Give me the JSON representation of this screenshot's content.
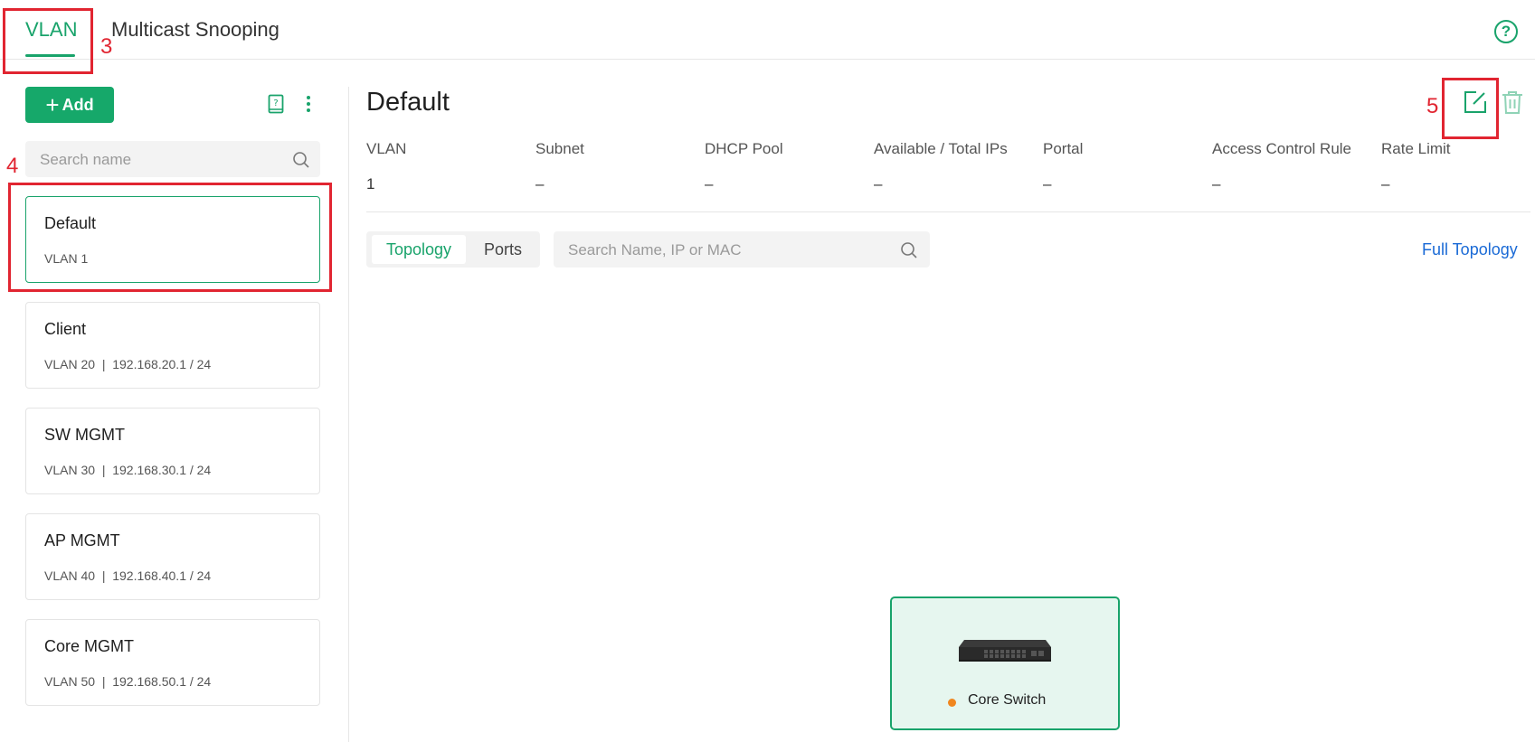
{
  "tabs": [
    {
      "label": "VLAN",
      "active": true
    },
    {
      "label": "Multicast Snooping",
      "active": false
    }
  ],
  "annotations": {
    "tab": "3",
    "list": "4",
    "edit": "5"
  },
  "left": {
    "add_label": "Add",
    "search_placeholder": "Search name",
    "vlans": [
      {
        "name": "Default",
        "sub": "VLAN 1",
        "selected": true
      },
      {
        "name": "Client",
        "sub": "VLAN 20  |  192.168.20.1 / 24",
        "selected": false
      },
      {
        "name": "SW MGMT",
        "sub": "VLAN 30  |  192.168.30.1 / 24",
        "selected": false
      },
      {
        "name": "AP MGMT",
        "sub": "VLAN 40  |  192.168.40.1 / 24",
        "selected": false
      },
      {
        "name": "Core MGMT",
        "sub": "VLAN 50  |  192.168.50.1 / 24",
        "selected": false
      }
    ]
  },
  "detail": {
    "title": "Default",
    "columns": [
      {
        "header": "VLAN",
        "value": "1"
      },
      {
        "header": "Subnet",
        "value": "–"
      },
      {
        "header": "DHCP Pool",
        "value": "–"
      },
      {
        "header": "Available / Total IPs",
        "value": "–"
      },
      {
        "header": "Portal",
        "value": "–"
      },
      {
        "header": "Access Control Rule",
        "value": "–"
      },
      {
        "header": "Rate Limit",
        "value": "–"
      }
    ],
    "segments": [
      "Topology",
      "Ports"
    ],
    "search_placeholder": "Search Name, IP or MAC",
    "full_topology_label": "Full Topology",
    "device": {
      "name": "Core Switch",
      "status_color": "#f0861f"
    }
  },
  "colors": {
    "accent": "#19a36b",
    "annotation": "#e12531",
    "link": "#1a6ad6"
  }
}
